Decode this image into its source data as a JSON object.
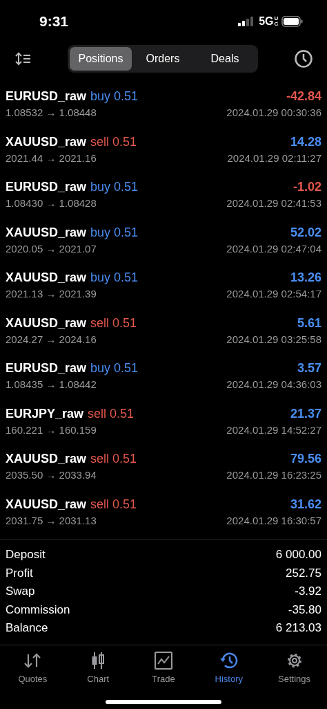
{
  "status_bar": {
    "time": "9:31",
    "network": "5G",
    "network_suffix": "UC"
  },
  "tabs": [
    {
      "label": "Positions",
      "selected": true
    },
    {
      "label": "Orders",
      "selected": false
    },
    {
      "label": "Deals",
      "selected": false
    }
  ],
  "deals": [
    {
      "symbol": "EURUSD_raw",
      "side": {
        "text": "buy 0.51",
        "color": "#4a8ef2"
      },
      "prices": "1.08532 → 1.08448",
      "profit": {
        "text": "-42.84",
        "color": "#e4574d"
      },
      "time": "2024.01.29 00:30:36"
    },
    {
      "symbol": "XAUUSD_raw",
      "side": {
        "text": "sell 0.51",
        "color": "#e4574d"
      },
      "prices": "2021.44 → 2021.16",
      "profit": {
        "text": "14.28",
        "color": "#4a8ef2"
      },
      "time": "2024.01.29 02:11:27"
    },
    {
      "symbol": "EURUSD_raw",
      "side": {
        "text": "buy 0.51",
        "color": "#4a8ef2"
      },
      "prices": "1.08430 → 1.08428",
      "profit": {
        "text": "-1.02",
        "color": "#e4574d"
      },
      "time": "2024.01.29 02:41:53"
    },
    {
      "symbol": "XAUUSD_raw",
      "side": {
        "text": "buy 0.51",
        "color": "#4a8ef2"
      },
      "prices": "2020.05 → 2021.07",
      "profit": {
        "text": "52.02",
        "color": "#4a8ef2"
      },
      "time": "2024.01.29 02:47:04"
    },
    {
      "symbol": "XAUUSD_raw",
      "side": {
        "text": "buy 0.51",
        "color": "#4a8ef2"
      },
      "prices": "2021.13 → 2021.39",
      "profit": {
        "text": "13.26",
        "color": "#4a8ef2"
      },
      "time": "2024.01.29 02:54:17"
    },
    {
      "symbol": "XAUUSD_raw",
      "side": {
        "text": "sell 0.51",
        "color": "#e4574d"
      },
      "prices": "2024.27 → 2024.16",
      "profit": {
        "text": "5.61",
        "color": "#4a8ef2"
      },
      "time": "2024.01.29 03:25:58"
    },
    {
      "symbol": "EURUSD_raw",
      "side": {
        "text": "buy 0.51",
        "color": "#4a8ef2"
      },
      "prices": "1.08435 → 1.08442",
      "profit": {
        "text": "3.57",
        "color": "#4a8ef2"
      },
      "time": "2024.01.29 04:36:03"
    },
    {
      "symbol": "EURJPY_raw",
      "side": {
        "text": "sell 0.51",
        "color": "#e4574d"
      },
      "prices": "160.221 → 160.159",
      "profit": {
        "text": "21.37",
        "color": "#4a8ef2"
      },
      "time": "2024.01.29 14:52:27"
    },
    {
      "symbol": "XAUUSD_raw",
      "side": {
        "text": "sell 0.51",
        "color": "#e4574d"
      },
      "prices": "2035.50 → 2033.94",
      "profit": {
        "text": "79.56",
        "color": "#4a8ef2"
      },
      "time": "2024.01.29 16:23:25"
    },
    {
      "symbol": "XAUUSD_raw",
      "side": {
        "text": "sell 0.51",
        "color": "#e4574d"
      },
      "prices": "2031.75 → 2031.13",
      "profit": {
        "text": "31.62",
        "color": "#4a8ef2"
      },
      "time": "2024.01.29 16:30:57"
    }
  ],
  "summary": [
    {
      "label": "Deposit",
      "value": "6 000.00"
    },
    {
      "label": "Profit",
      "value": "252.75"
    },
    {
      "label": "Swap",
      "value": "-3.92"
    },
    {
      "label": "Commission",
      "value": "-35.80"
    },
    {
      "label": "Balance",
      "value": "6 213.03"
    }
  ],
  "nav": [
    {
      "label": "Quotes",
      "selected": false
    },
    {
      "label": "Chart",
      "selected": false
    },
    {
      "label": "Trade",
      "selected": false
    },
    {
      "label": "History",
      "selected": true
    },
    {
      "label": "Settings",
      "selected": false
    }
  ]
}
